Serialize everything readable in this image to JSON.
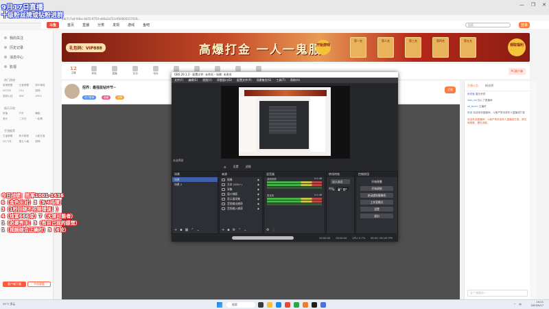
{
  "browser": {
    "url": "b9c7c7a4-94bc-4b55-9754-eb6a2a72cc950000317018...",
    "controls": [
      "—",
      "❐",
      "✕"
    ]
  },
  "site_nav": {
    "logo": "斗鱼",
    "items": [
      "首页",
      "直播",
      "分类",
      "发现",
      "游戏",
      "鱼吧"
    ],
    "search_placeholder": "搜索...",
    "login": "登录"
  },
  "banner": {
    "left_badge": "礼包码：VIP888",
    "title": "高爆打金 一人一鬼服",
    "cta": "开始游戏",
    "prizes": [
      "第一名",
      "第二名",
      "第三名",
      "第四名",
      "第五名"
    ],
    "right_badge": "领取福利"
  },
  "sidebar": {
    "items": [
      "我的关注",
      "历史记录",
      "消息中心",
      "影视"
    ],
    "section_hot": "热门游戏",
    "hot_grid": [
      "英雄联盟",
      "王者荣耀",
      "和平精英",
      "DOTA2",
      "CS2",
      "原神",
      "穿越火线",
      "DNF",
      "APEX"
    ],
    "section_fun": "娱乐天地",
    "fun_grid": [
      "颜值",
      "户外",
      "舞蹈",
      "音乐",
      "二次元",
      "一起看"
    ],
    "section_mobile": "手游推荐",
    "mobile_grid": [
      "王者荣耀",
      "和平精英",
      "火影忍者",
      "QQ飞车",
      "第五人格",
      "原神"
    ],
    "bottom_btn1": "客户端下载",
    "bottom_btn2": "手机观看"
  },
  "stats_row": {
    "count": "12",
    "cells": [
      "主播",
      "体验",
      "直播",
      "互动",
      "电台",
      "投稿",
      "收益",
      "鱼吧",
      "任务",
      "开播"
    ],
    "client_btn": "PC客户端"
  },
  "stream": {
    "title": "招界：最强蓝钻环节~",
    "tags": [
      "热门推荐",
      "收藏",
      "分享"
    ],
    "follow": "订阅"
  },
  "chat": {
    "tabs": [
      "主播公告",
      "粉丝榜"
    ],
    "lines": [
      {
        "name": "贵宾席",
        "text": "暂无贵宾"
      },
      {
        "name": "xiao_bo",
        "text": "加入了直播间"
      },
      {
        "name": "sa_buzhi",
        "text": "主播好"
      },
      {
        "name": "系统",
        "text": "欢迎来到直播间，斗鱼严禁未成年人直播或打赏"
      }
    ],
    "notice": "欢迎来到直播间！斗鱼严禁未成年人直播或打赏，请文明观看，理性消费。",
    "input_placeholder": "发个弹幕呗~"
  },
  "obs": {
    "title": "OBS 29.1.3 - 配置文件: 未命名 - 场景: 未命名",
    "menu": [
      "文件(F)",
      "编辑(E)",
      "视图(V)",
      "停靠窗口(D)",
      "配置文件(P)",
      "场景集合(S)",
      "工具(T)",
      "帮助(H)"
    ],
    "preview_tabs": [
      "设置",
      "滤镜"
    ],
    "scenes_header": "场景",
    "scenes": [
      "场景",
      "场景 2"
    ],
    "no_source": "未选择源",
    "sources_header": "来源",
    "sources": [
      "图像",
      "文本 (GDI+)",
      "采集",
      "窗口捕获",
      "显示器采集",
      "音频输出捕获",
      "音频输入捕获"
    ],
    "mixer_header": "混音器",
    "mixer_tracks": [
      {
        "name": "桌面音频",
        "db": "0.0 dB"
      },
      {
        "name": "麦克风",
        "db": "0.0 dB"
      }
    ],
    "transitions_header": "转场特效",
    "transition_type": "淡入淡出",
    "duration_label": "时长",
    "duration_value": "300 ms",
    "controls_header": "控制按钮",
    "controls": [
      "开始直播",
      "开始录制",
      "启动虚拟摄像机",
      "工作室模式",
      "设置",
      "退出"
    ],
    "status": [
      "00:00:00",
      "00:00:00",
      "CPU: 0.7%",
      "60.00 / 60.00 FPS"
    ]
  },
  "overlay": {
    "date": "9月17日直播",
    "subtitle": "十级粉丝牌或钻粉进群",
    "lines": [
      "今日战绩：胜率1001-1436",
      "6（金色出对）3（9/4吗猜）",
      "3（1秒回拨不吃得错误！）",
      "4（炫富666成）7（大道可能者）",
      "1（必要秀手）3（有自己我的感觉）",
      "1（视频综合正确时）3（6论）"
    ]
  },
  "taskbar": {
    "weather": "25°C 多云",
    "search": "搜索",
    "time": "14:21",
    "date": "2023/9/17",
    "tray": [
      "中",
      "⌃"
    ]
  },
  "colors": {
    "accent": "#ff7b3a",
    "overlay_blue": "#2c3fd1",
    "overlay_red": "#e01b1b",
    "obs_bg": "#26272b"
  }
}
